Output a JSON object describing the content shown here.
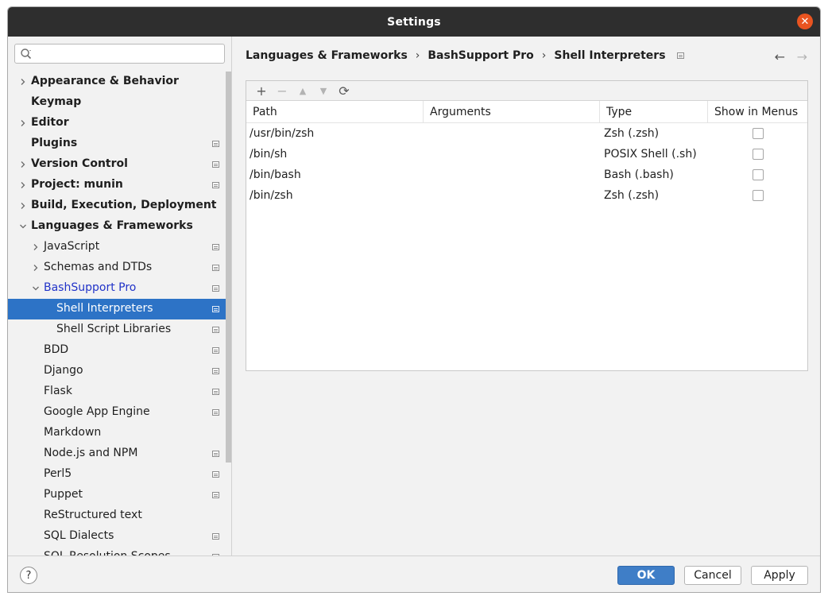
{
  "window": {
    "title": "Settings"
  },
  "search": {
    "placeholder": "",
    "value": ""
  },
  "sidebar": {
    "items": [
      {
        "label": "Appearance & Behavior",
        "level": 0,
        "expandable": true,
        "expanded": false,
        "bold": true,
        "config_icon": false
      },
      {
        "label": "Keymap",
        "level": 0,
        "expandable": false,
        "bold": true,
        "config_icon": false
      },
      {
        "label": "Editor",
        "level": 0,
        "expandable": true,
        "expanded": false,
        "bold": true,
        "config_icon": false
      },
      {
        "label": "Plugins",
        "level": 0,
        "expandable": false,
        "bold": true,
        "config_icon": true
      },
      {
        "label": "Version Control",
        "level": 0,
        "expandable": true,
        "expanded": false,
        "bold": true,
        "config_icon": true
      },
      {
        "label": "Project: munin",
        "level": 0,
        "expandable": true,
        "expanded": false,
        "bold": true,
        "config_icon": true
      },
      {
        "label": "Build, Execution, Deployment",
        "level": 0,
        "expandable": true,
        "expanded": false,
        "bold": true,
        "config_icon": false
      },
      {
        "label": "Languages & Frameworks",
        "level": 0,
        "expandable": true,
        "expanded": true,
        "bold": true,
        "config_icon": false
      },
      {
        "label": "JavaScript",
        "level": 1,
        "expandable": true,
        "expanded": false,
        "bold": false,
        "config_icon": true
      },
      {
        "label": "Schemas and DTDs",
        "level": 1,
        "expandable": true,
        "expanded": false,
        "bold": false,
        "config_icon": true
      },
      {
        "label": "BashSupport Pro",
        "level": 1,
        "expandable": true,
        "expanded": true,
        "bold": false,
        "config_icon": true,
        "link": true
      },
      {
        "label": "Shell Interpreters",
        "level": 2,
        "expandable": false,
        "bold": false,
        "config_icon": true,
        "selected": true
      },
      {
        "label": "Shell Script Libraries",
        "level": 2,
        "expandable": false,
        "bold": false,
        "config_icon": true
      },
      {
        "label": "BDD",
        "level": 1,
        "expandable": false,
        "bold": false,
        "config_icon": true
      },
      {
        "label": "Django",
        "level": 1,
        "expandable": false,
        "bold": false,
        "config_icon": true
      },
      {
        "label": "Flask",
        "level": 1,
        "expandable": false,
        "bold": false,
        "config_icon": true
      },
      {
        "label": "Google App Engine",
        "level": 1,
        "expandable": false,
        "bold": false,
        "config_icon": true
      },
      {
        "label": "Markdown",
        "level": 1,
        "expandable": false,
        "bold": false,
        "config_icon": false
      },
      {
        "label": "Node.js and NPM",
        "level": 1,
        "expandable": false,
        "bold": false,
        "config_icon": true
      },
      {
        "label": "Perl5",
        "level": 1,
        "expandable": false,
        "bold": false,
        "config_icon": true
      },
      {
        "label": "Puppet",
        "level": 1,
        "expandable": false,
        "bold": false,
        "config_icon": true
      },
      {
        "label": "ReStructured text",
        "level": 1,
        "expandable": false,
        "bold": false,
        "config_icon": false
      },
      {
        "label": "SQL Dialects",
        "level": 1,
        "expandable": false,
        "bold": false,
        "config_icon": true
      },
      {
        "label": "SQL Resolution Scopes",
        "level": 1,
        "expandable": false,
        "bold": false,
        "config_icon": true
      }
    ]
  },
  "breadcrumb": {
    "items": [
      "Languages & Frameworks",
      "BashSupport Pro",
      "Shell Interpreters"
    ],
    "separator": "›"
  },
  "nav": {
    "back": "←",
    "forward": "→"
  },
  "toolbar": {
    "add": "+",
    "remove": "−",
    "move_up": "▲",
    "move_down": "▼",
    "refresh": "⟳"
  },
  "table": {
    "columns": [
      "Path",
      "Arguments",
      "Type",
      "Show in Menus"
    ],
    "rows": [
      {
        "path": "/usr/bin/zsh",
        "arguments": "",
        "type": "Zsh (.zsh)",
        "show_in_menus": false
      },
      {
        "path": "/bin/sh",
        "arguments": "",
        "type": "POSIX Shell (.sh)",
        "show_in_menus": false
      },
      {
        "path": "/bin/bash",
        "arguments": "",
        "type": "Bash (.bash)",
        "show_in_menus": false
      },
      {
        "path": "/bin/zsh",
        "arguments": "",
        "type": "Zsh (.zsh)",
        "show_in_menus": false
      }
    ]
  },
  "footer": {
    "help": "?",
    "ok": "OK",
    "cancel": "Cancel",
    "apply": "Apply"
  },
  "colors": {
    "selection": "#2d73c6",
    "link": "#2133c8",
    "ok_button": "#3f7ec7",
    "close_button": "#e95420",
    "titlebar": "#2e2e2e"
  }
}
